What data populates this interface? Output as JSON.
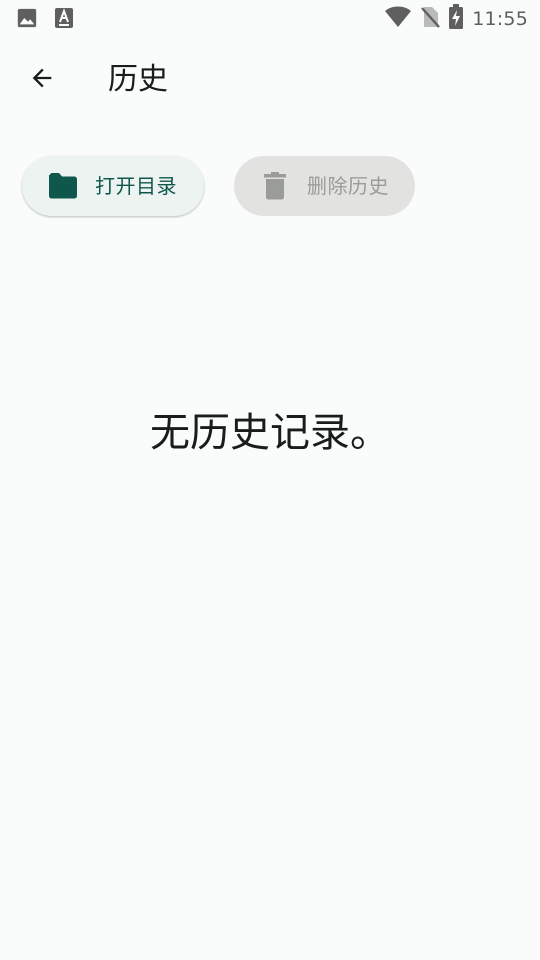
{
  "status_bar": {
    "time": "11:55",
    "left_icons": [
      "image-icon",
      "font-icon"
    ],
    "right_icons": [
      "wifi-icon",
      "no-sim-icon",
      "battery-charging-icon"
    ]
  },
  "app_bar": {
    "back_icon": "arrow-back-icon",
    "title": "历史"
  },
  "actions": {
    "open_directory": {
      "label": "打开目录",
      "icon": "folder-icon",
      "enabled": true
    },
    "delete_history": {
      "label": "删除历史",
      "icon": "trash-icon",
      "enabled": false
    }
  },
  "empty_state": {
    "message": "无历史记录。"
  },
  "colors": {
    "background": "#f9fcfb",
    "primary": "#0f574c",
    "disabled_text": "#9a9c9a",
    "disabled_chip": "#e2e3e1",
    "tonal_chip": "#edf3f1"
  }
}
